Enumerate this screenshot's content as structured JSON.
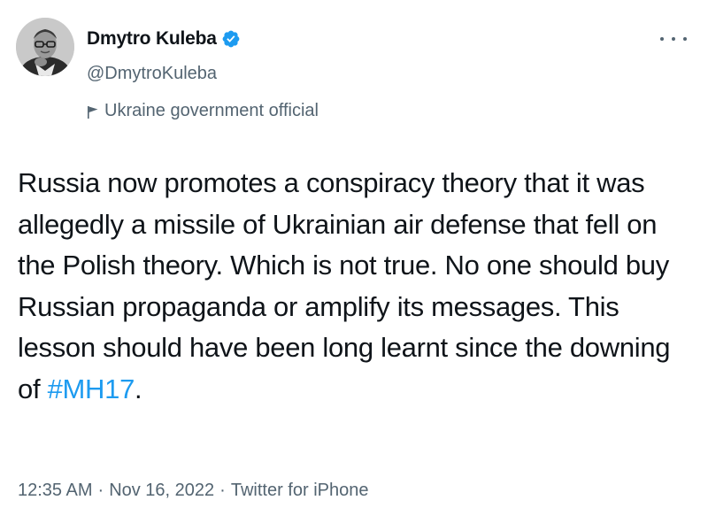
{
  "author": {
    "display_name": "Dmytro Kuleba",
    "handle": "@DmytroKuleba",
    "label": "Ukraine government official",
    "verified": true,
    "verified_icon": "verified-badge-icon",
    "label_icon": "flag-icon"
  },
  "menu": {
    "icon": "more-options-icon"
  },
  "tweet": {
    "lines": [
      "Russia now promotes a conspiracy theory that it was",
      "allegedly a missile of Ukrainian air defense that fell on",
      "the Polish theory. Which is not true. No one should buy",
      "Russian propaganda or amplify its messages. This",
      "lesson should have been long learnt since the downing"
    ],
    "last_line_prefix": "of ",
    "hashtag": "#MH17",
    "last_line_suffix": "."
  },
  "meta": {
    "time": "12:35 AM",
    "separator": "·",
    "date": "Nov 16, 2022",
    "source": "Twitter for iPhone"
  },
  "colors": {
    "text": "#0f1419",
    "secondary": "#536471",
    "accent": "#1d9bf0"
  }
}
